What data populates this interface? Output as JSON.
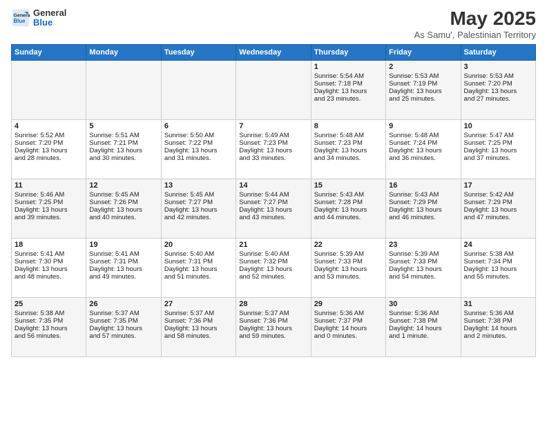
{
  "header": {
    "logo_general": "General",
    "logo_blue": "Blue",
    "month_title": "May 2025",
    "subtitle": "As Samu', Palestinian Territory"
  },
  "days_of_week": [
    "Sunday",
    "Monday",
    "Tuesday",
    "Wednesday",
    "Thursday",
    "Friday",
    "Saturday"
  ],
  "weeks": [
    [
      {
        "day": "",
        "content": ""
      },
      {
        "day": "",
        "content": ""
      },
      {
        "day": "",
        "content": ""
      },
      {
        "day": "",
        "content": ""
      },
      {
        "day": "1",
        "content": "Sunrise: 5:54 AM\nSunset: 7:18 PM\nDaylight: 13 hours\nand 23 minutes."
      },
      {
        "day": "2",
        "content": "Sunrise: 5:53 AM\nSunset: 7:19 PM\nDaylight: 13 hours\nand 25 minutes."
      },
      {
        "day": "3",
        "content": "Sunrise: 5:53 AM\nSunset: 7:20 PM\nDaylight: 13 hours\nand 27 minutes."
      }
    ],
    [
      {
        "day": "4",
        "content": "Sunrise: 5:52 AM\nSunset: 7:20 PM\nDaylight: 13 hours\nand 28 minutes."
      },
      {
        "day": "5",
        "content": "Sunrise: 5:51 AM\nSunset: 7:21 PM\nDaylight: 13 hours\nand 30 minutes."
      },
      {
        "day": "6",
        "content": "Sunrise: 5:50 AM\nSunset: 7:22 PM\nDaylight: 13 hours\nand 31 minutes."
      },
      {
        "day": "7",
        "content": "Sunrise: 5:49 AM\nSunset: 7:23 PM\nDaylight: 13 hours\nand 33 minutes."
      },
      {
        "day": "8",
        "content": "Sunrise: 5:48 AM\nSunset: 7:23 PM\nDaylight: 13 hours\nand 34 minutes."
      },
      {
        "day": "9",
        "content": "Sunrise: 5:48 AM\nSunset: 7:24 PM\nDaylight: 13 hours\nand 36 minutes."
      },
      {
        "day": "10",
        "content": "Sunrise: 5:47 AM\nSunset: 7:25 PM\nDaylight: 13 hours\nand 37 minutes."
      }
    ],
    [
      {
        "day": "11",
        "content": "Sunrise: 5:46 AM\nSunset: 7:25 PM\nDaylight: 13 hours\nand 39 minutes."
      },
      {
        "day": "12",
        "content": "Sunrise: 5:45 AM\nSunset: 7:26 PM\nDaylight: 13 hours\nand 40 minutes."
      },
      {
        "day": "13",
        "content": "Sunrise: 5:45 AM\nSunset: 7:27 PM\nDaylight: 13 hours\nand 42 minutes."
      },
      {
        "day": "14",
        "content": "Sunrise: 5:44 AM\nSunset: 7:27 PM\nDaylight: 13 hours\nand 43 minutes."
      },
      {
        "day": "15",
        "content": "Sunrise: 5:43 AM\nSunset: 7:28 PM\nDaylight: 13 hours\nand 44 minutes."
      },
      {
        "day": "16",
        "content": "Sunrise: 5:43 AM\nSunset: 7:29 PM\nDaylight: 13 hours\nand 46 minutes."
      },
      {
        "day": "17",
        "content": "Sunrise: 5:42 AM\nSunset: 7:29 PM\nDaylight: 13 hours\nand 47 minutes."
      }
    ],
    [
      {
        "day": "18",
        "content": "Sunrise: 5:41 AM\nSunset: 7:30 PM\nDaylight: 13 hours\nand 48 minutes."
      },
      {
        "day": "19",
        "content": "Sunrise: 5:41 AM\nSunset: 7:31 PM\nDaylight: 13 hours\nand 49 minutes."
      },
      {
        "day": "20",
        "content": "Sunrise: 5:40 AM\nSunset: 7:31 PM\nDaylight: 13 hours\nand 51 minutes."
      },
      {
        "day": "21",
        "content": "Sunrise: 5:40 AM\nSunset: 7:32 PM\nDaylight: 13 hours\nand 52 minutes."
      },
      {
        "day": "22",
        "content": "Sunrise: 5:39 AM\nSunset: 7:33 PM\nDaylight: 13 hours\nand 53 minutes."
      },
      {
        "day": "23",
        "content": "Sunrise: 5:39 AM\nSunset: 7:33 PM\nDaylight: 13 hours\nand 54 minutes."
      },
      {
        "day": "24",
        "content": "Sunrise: 5:38 AM\nSunset: 7:34 PM\nDaylight: 13 hours\nand 55 minutes."
      }
    ],
    [
      {
        "day": "25",
        "content": "Sunrise: 5:38 AM\nSunset: 7:35 PM\nDaylight: 13 hours\nand 56 minutes."
      },
      {
        "day": "26",
        "content": "Sunrise: 5:37 AM\nSunset: 7:35 PM\nDaylight: 13 hours\nand 57 minutes."
      },
      {
        "day": "27",
        "content": "Sunrise: 5:37 AM\nSunset: 7:36 PM\nDaylight: 13 hours\nand 58 minutes."
      },
      {
        "day": "28",
        "content": "Sunrise: 5:37 AM\nSunset: 7:36 PM\nDaylight: 13 hours\nand 59 minutes."
      },
      {
        "day": "29",
        "content": "Sunrise: 5:36 AM\nSunset: 7:37 PM\nDaylight: 14 hours\nand 0 minutes."
      },
      {
        "day": "30",
        "content": "Sunrise: 5:36 AM\nSunset: 7:38 PM\nDaylight: 14 hours\nand 1 minute."
      },
      {
        "day": "31",
        "content": "Sunrise: 5:36 AM\nSunset: 7:38 PM\nDaylight: 14 hours\nand 2 minutes."
      }
    ]
  ]
}
